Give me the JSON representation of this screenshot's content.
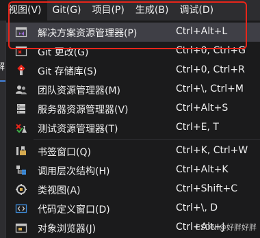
{
  "menubar": {
    "items": [
      {
        "label": "视图(V)"
      },
      {
        "label": "Git(G)"
      },
      {
        "label": "项目(P)"
      },
      {
        "label": "生成(B)"
      },
      {
        "label": "调试(D)"
      }
    ]
  },
  "left_fragment": "解",
  "menu": {
    "items": [
      {
        "label": "解决方案资源管理器(P)",
        "shortcut": "Ctrl+Alt+L",
        "icon": "solution-explorer-icon"
      },
      {
        "label": "Git 更改(G)",
        "shortcut": "Ctrl+0, Ctrl+G",
        "icon": "git-changes-icon"
      },
      {
        "label": "Git 存储库(S)",
        "shortcut": "Ctrl+0, Ctrl+R",
        "icon": "git-repository-icon"
      },
      {
        "label": "团队资源管理器(M)",
        "shortcut": "Ctrl+\\, Ctrl+M",
        "icon": "team-explorer-icon"
      },
      {
        "label": "服务器资源管理器(V)",
        "shortcut": "Ctrl+Alt+S",
        "icon": "server-explorer-icon"
      },
      {
        "label": "测试资源管理器(T)",
        "shortcut": "Ctrl+E, T",
        "icon": "test-explorer-icon"
      },
      {
        "label": "书签窗口(Q)",
        "shortcut": "Ctrl+K, Ctrl+W",
        "icon": "bookmark-window-icon"
      },
      {
        "label": "调用层次结构(H)",
        "shortcut": "Ctrl+Alt+K",
        "icon": "call-hierarchy-icon"
      },
      {
        "label": "类视图(A)",
        "shortcut": "Ctrl+Shift+C",
        "icon": "class-view-icon"
      },
      {
        "label": "代码定义窗口(D)",
        "shortcut": "Ctrl+\\, D",
        "icon": "code-definition-icon"
      },
      {
        "label": "对象浏览器(J)",
        "shortcut": "Ctrl+Alt+J",
        "icon": "object-browser-icon"
      }
    ]
  },
  "colors": {
    "highlight_box": "#e8251a",
    "accent_purple": "#9b6ad6",
    "accent_blue": "#3e8ede",
    "background": "#1b1b1c"
  },
  "watermark": "CSDN @好胖好胖"
}
